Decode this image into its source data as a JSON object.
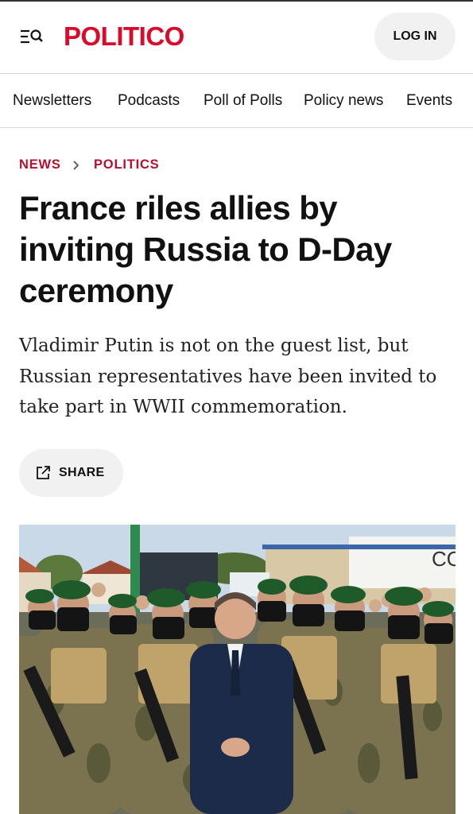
{
  "header": {
    "logo_text": "POLITICO",
    "login_label": "LOG IN",
    "menu_icon": "menu-search-icon",
    "brand_color": "#dc0a2a"
  },
  "nav": {
    "items": [
      {
        "label": "Newsletters"
      },
      {
        "label": "Podcasts"
      },
      {
        "label": "Poll of Polls"
      },
      {
        "label": "Policy news"
      },
      {
        "label": "Events"
      }
    ]
  },
  "breadcrumb": {
    "items": [
      "NEWS",
      "POLITICS"
    ],
    "separator_icon": "chevron-right-icon",
    "color": "#b5112e"
  },
  "article": {
    "headline": "France riles allies by inviting Russia to D-Day ceremony",
    "dek": "Vladimir Putin is not on the guest list, but Russian representatives have been invited to take part in WWII commemoration.",
    "share_label": "SHARE",
    "share_icon": "external-share-icon"
  },
  "photo": {
    "sign_text": "CO"
  }
}
